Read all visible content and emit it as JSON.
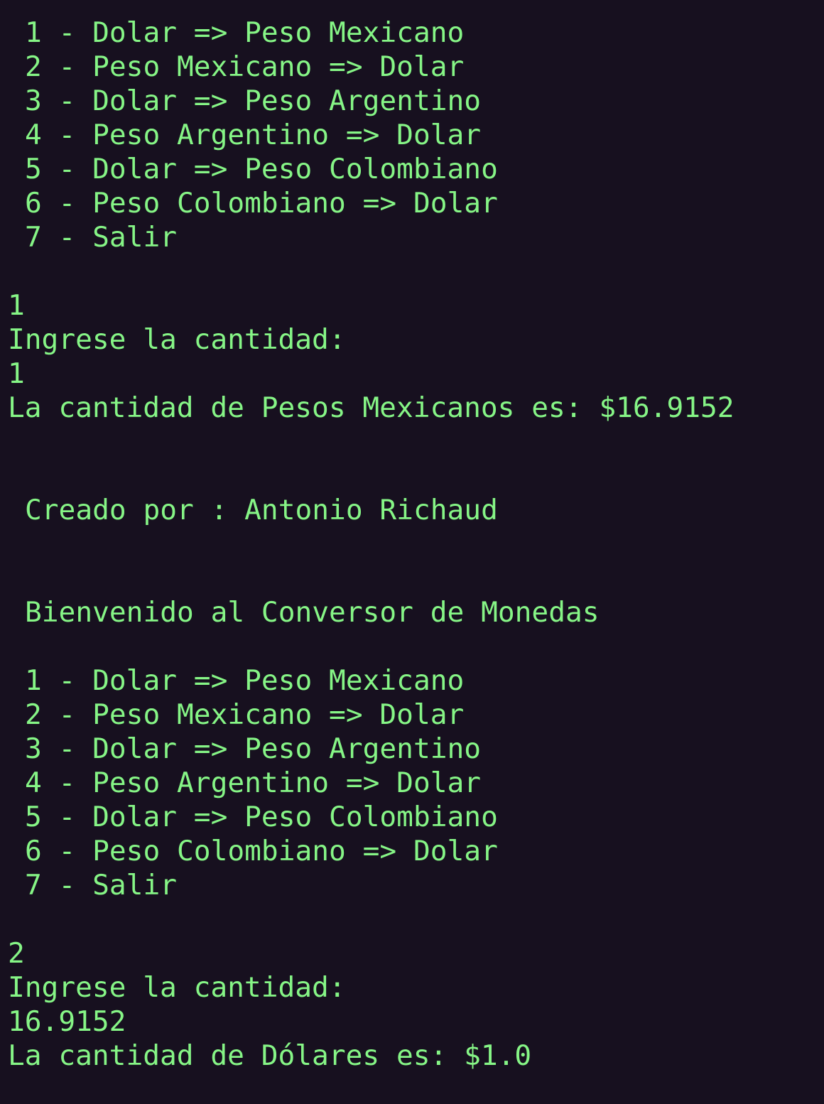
{
  "terminal": {
    "lines": [
      {
        "text": "1 - Dolar => Peso Mexicano",
        "indent": true,
        "kind": "menu-option"
      },
      {
        "text": "2 - Peso Mexicano => Dolar",
        "indent": true,
        "kind": "menu-option"
      },
      {
        "text": "3 - Dolar => Peso Argentino",
        "indent": true,
        "kind": "menu-option"
      },
      {
        "text": "4 - Peso Argentino => Dolar",
        "indent": true,
        "kind": "menu-option"
      },
      {
        "text": "5 - Dolar => Peso Colombiano",
        "indent": true,
        "kind": "menu-option"
      },
      {
        "text": "6 - Peso Colombiano => Dolar",
        "indent": true,
        "kind": "menu-option"
      },
      {
        "text": "7 - Salir",
        "indent": true,
        "kind": "menu-option"
      },
      {
        "text": "",
        "indent": false,
        "kind": "blank"
      },
      {
        "text": "1",
        "indent": false,
        "kind": "user-input"
      },
      {
        "text": "Ingrese la cantidad:",
        "indent": false,
        "kind": "prompt"
      },
      {
        "text": "1",
        "indent": false,
        "kind": "user-input"
      },
      {
        "text": "La cantidad de Pesos Mexicanos es: $16.9152",
        "indent": false,
        "kind": "result"
      },
      {
        "text": "",
        "indent": false,
        "kind": "blank"
      },
      {
        "text": "",
        "indent": false,
        "kind": "blank"
      },
      {
        "text": "Creado por : Antonio Richaud",
        "indent": true,
        "kind": "credit"
      },
      {
        "text": "",
        "indent": false,
        "kind": "blank"
      },
      {
        "text": "",
        "indent": false,
        "kind": "blank"
      },
      {
        "text": "Bienvenido al Conversor de Monedas",
        "indent": true,
        "kind": "welcome"
      },
      {
        "text": "",
        "indent": false,
        "kind": "blank"
      },
      {
        "text": "1 - Dolar => Peso Mexicano",
        "indent": true,
        "kind": "menu-option"
      },
      {
        "text": "2 - Peso Mexicano => Dolar",
        "indent": true,
        "kind": "menu-option"
      },
      {
        "text": "3 - Dolar => Peso Argentino",
        "indent": true,
        "kind": "menu-option"
      },
      {
        "text": "4 - Peso Argentino => Dolar",
        "indent": true,
        "kind": "menu-option"
      },
      {
        "text": "5 - Dolar => Peso Colombiano",
        "indent": true,
        "kind": "menu-option"
      },
      {
        "text": "6 - Peso Colombiano => Dolar",
        "indent": true,
        "kind": "menu-option"
      },
      {
        "text": "7 - Salir",
        "indent": true,
        "kind": "menu-option"
      },
      {
        "text": "",
        "indent": false,
        "kind": "blank"
      },
      {
        "text": "2",
        "indent": false,
        "kind": "user-input"
      },
      {
        "text": "Ingrese la cantidad:",
        "indent": false,
        "kind": "prompt"
      },
      {
        "text": "16.9152",
        "indent": false,
        "kind": "user-input"
      },
      {
        "text": "La cantidad de Dólares es: $1.0",
        "indent": false,
        "kind": "result"
      }
    ],
    "colors": {
      "background": "#17101f",
      "text": "#86f586"
    }
  }
}
